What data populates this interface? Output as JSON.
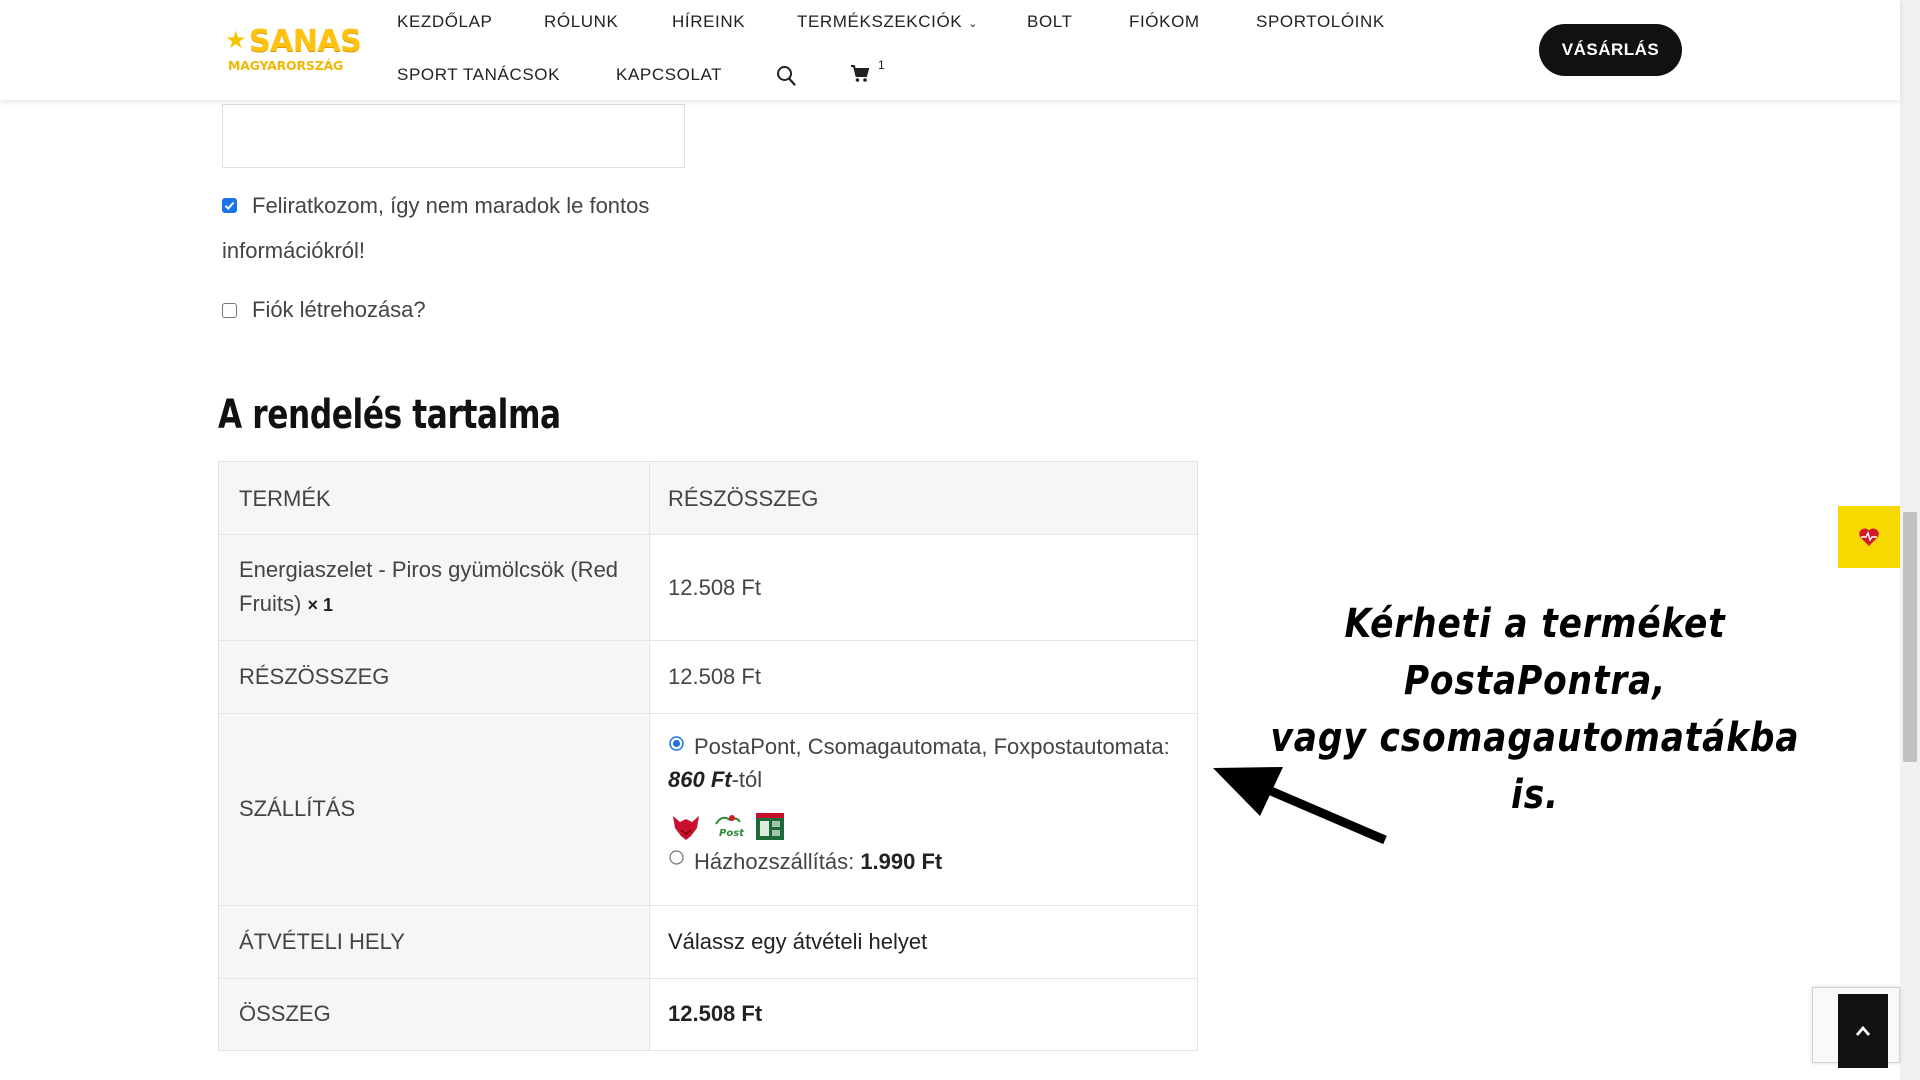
{
  "brand": {
    "line1": "SANAS",
    "line2": "MAGYARORSZÁG"
  },
  "nav": {
    "items": [
      "KEZDŐLAP",
      "RÓLUNK",
      "HÍREINK",
      "TERMÉKSZEKCIÓK",
      "BOLT",
      "FIÓKOM",
      "SPORTOLÓINK",
      "SPORT TANÁCSOK",
      "KAPCSOLAT"
    ],
    "cart_count": "1",
    "buy_label": "VÁSÁRLÁS"
  },
  "form": {
    "newsletter_label_line1": "Feliratkozom, így nem maradok le fontos",
    "newsletter_label_line2": "információkról!",
    "newsletter_checked": true,
    "create_account_label": "Fiók létrehozása?",
    "create_account_checked": false
  },
  "order": {
    "title": "A rendelés tartalma",
    "headers": [
      "TERMÉK",
      "RÉSZÖSSZEG"
    ],
    "product_name_line1": "Energiaszelet - Piros gyümölcsök (Red",
    "product_name_line2": "Fruits)",
    "product_qty": "× 1",
    "product_price": "12.508 Ft",
    "subtotal_label": "RÉSZÖSSZEG",
    "subtotal_value": "12.508 Ft",
    "shipping_label": "SZÁLLÍTÁS",
    "shipping_option1": "PostaPont, Csomagautomata, Foxpostautomata:",
    "shipping_option1_price": "860 Ft",
    "shipping_option1_suffix": "-tól",
    "shipping_option2_label": "Házhozszállítás:",
    "shipping_option2_price": "1.990 Ft",
    "pickup_label": "ÁTVÉTELI HELY",
    "pickup_value": "Válassz egy átvételi helyet",
    "total_label": "ÖSSZEG",
    "total_value": "12.508 Ft"
  },
  "annotation": {
    "line1": "Kérheti a terméket PostaPontra,",
    "line2": "vagy csomagautomatákba is."
  },
  "colors": {
    "accent_yellow": "#f7d800",
    "logo_yellow": "#ffc20e",
    "button_dark": "#111111",
    "heart_red": "#d11a2a"
  },
  "icons": [
    "search-icon",
    "cart-icon",
    "chevron-down-icon",
    "fox-icon",
    "posta-icon",
    "parcel-locker-icon",
    "heart-pulse-icon",
    "chevron-up-icon"
  ]
}
